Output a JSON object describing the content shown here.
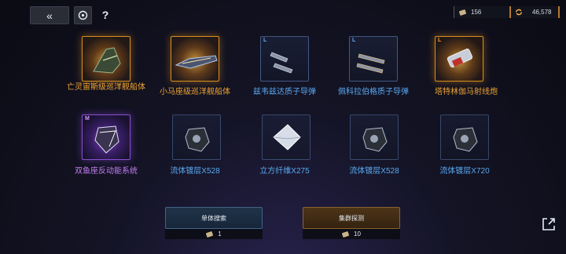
{
  "topbar": {
    "help_label": "?",
    "tickets": "156",
    "coins": "46,578"
  },
  "items": [
    {
      "label": "亡灵宙斯级巡洋舰船体",
      "tag": "",
      "rarity": "gold"
    },
    {
      "label": "小马座级巡洋舰船体",
      "tag": "",
      "rarity": "gold"
    },
    {
      "label": "兹韦兹达质子导弹",
      "tag": "L",
      "rarity": "blue"
    },
    {
      "label": "佩科拉伯格质子导弹",
      "tag": "L",
      "rarity": "blue"
    },
    {
      "label": "塔特林伽马射线炮",
      "tag": "L",
      "rarity": "gold"
    },
    {
      "label": "双鱼座反动能系统",
      "tag": "M",
      "rarity": "purple"
    },
    {
      "label": "流体镀层X528",
      "tag": "",
      "rarity": "blue"
    },
    {
      "label": "立方纤维X275",
      "tag": "",
      "rarity": "blue"
    },
    {
      "label": "流体镀层X528",
      "tag": "",
      "rarity": "blue"
    },
    {
      "label": "流体镀层X720",
      "tag": "",
      "rarity": "blue"
    }
  ],
  "actions": {
    "single_label": "单体搜索",
    "single_cost": "1",
    "cluster_label": "集群探测",
    "cluster_cost": "10"
  },
  "colors": {
    "gold": "#f0a532",
    "blue": "#5aa9f0",
    "purple": "#c47ef5"
  }
}
